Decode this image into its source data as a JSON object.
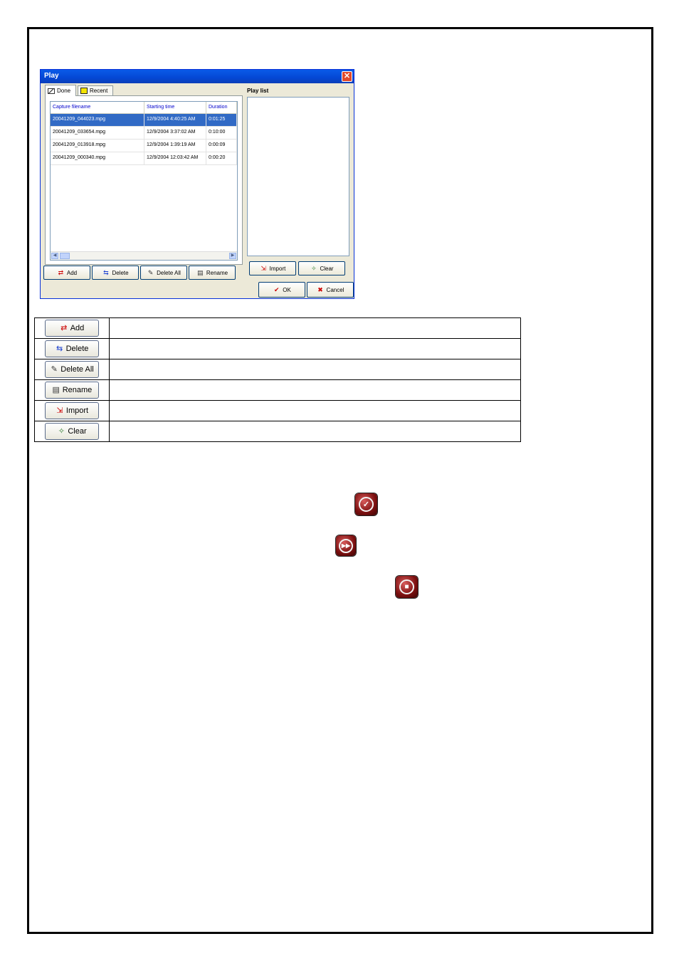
{
  "window": {
    "title": "Play",
    "close_glyph": "✕",
    "tabs": [
      {
        "label": "Done",
        "icon": "done-icon",
        "active": true
      },
      {
        "label": "Recent",
        "icon": "recent-icon",
        "active": false
      }
    ],
    "list": {
      "columns": [
        "Capture filename",
        "Starting time",
        "Duration"
      ],
      "rows": [
        {
          "filename": "20041209_044023.mpg",
          "start": "12/9/2004 4:40:25 AM",
          "duration": "0:01:25",
          "selected": true
        },
        {
          "filename": "20041209_033654.mpg",
          "start": "12/9/2004 3:37:02 AM",
          "duration": "0:10:00",
          "selected": false
        },
        {
          "filename": "20041209_013918.mpg",
          "start": "12/9/2004 1:39:19 AM",
          "duration": "0:00:09",
          "selected": false
        },
        {
          "filename": "20041209_000340.mpg",
          "start": "12/9/2004 12:03:42 AM",
          "duration": "0:00:20",
          "selected": false
        }
      ]
    },
    "buttons": {
      "add": "Add",
      "delete": "Delete",
      "delete_all": "Delete All",
      "rename": "Rename",
      "import": "Import",
      "clear": "Clear",
      "ok": "OK",
      "cancel": "Cancel"
    },
    "playlist_label": "Play list"
  },
  "button_table": [
    {
      "label": "Add",
      "icon": "add-icon"
    },
    {
      "label": "Delete",
      "icon": "delete-icon"
    },
    {
      "label": "Delete All",
      "icon": "delete-all-icon"
    },
    {
      "label": "Rename",
      "icon": "rename-icon"
    },
    {
      "label": "Import",
      "icon": "import-icon"
    },
    {
      "label": "Clear",
      "icon": "clear-icon"
    }
  ],
  "round_icons": [
    "play-list-icon",
    "fast-forward-icon",
    "stop-icon"
  ],
  "colors": {
    "titlebar": "#0a5be8",
    "selection": "#316ac5",
    "round_icon": "#7a0f0f"
  }
}
